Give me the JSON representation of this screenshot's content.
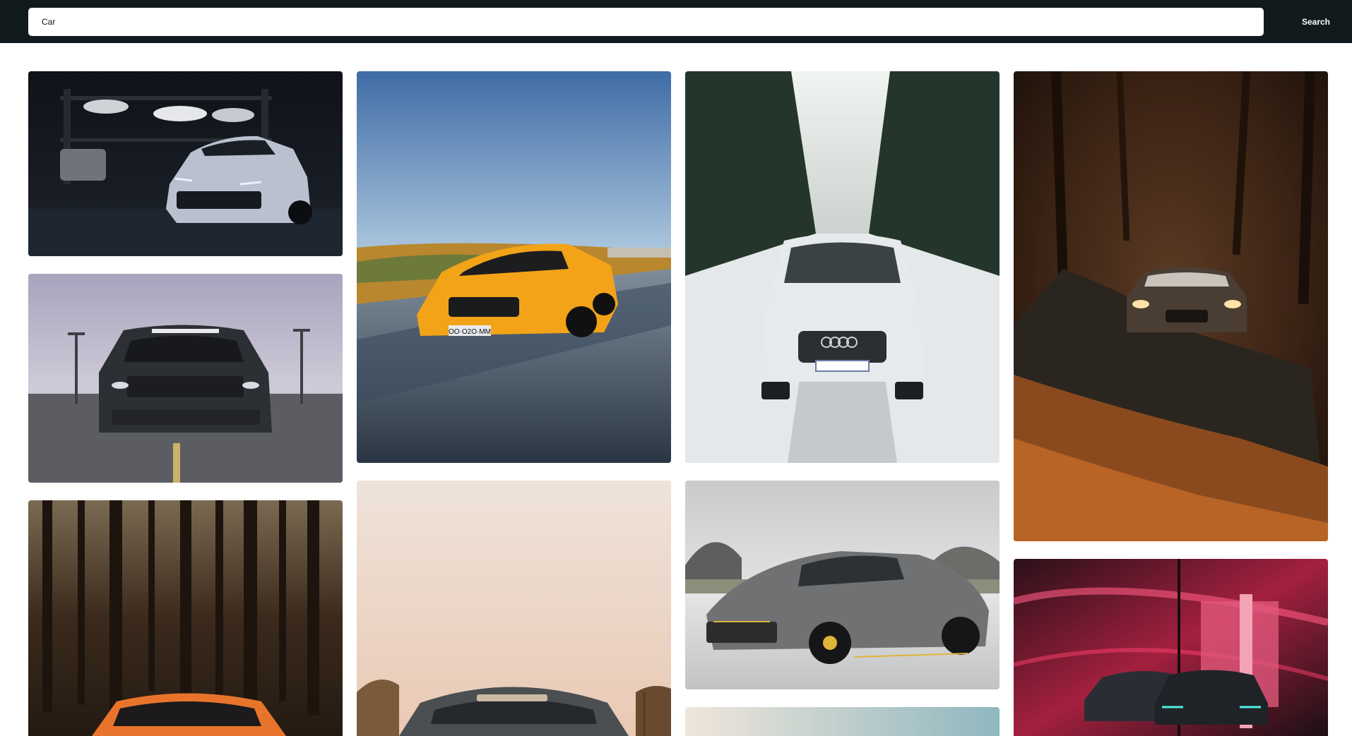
{
  "search": {
    "value": "Car",
    "placeholder": "",
    "button_label": "Search"
  },
  "results": [
    {
      "subject": "white Chevrolet Camaro in dark garage with stacked cars"
    },
    {
      "subject": "gray Ford Mustang Steeda on empty parking lot under cloudy sky"
    },
    {
      "subject": "orange sports car in dark autumn forest"
    },
    {
      "subject": "yellow Mercedes-AMG GT driving on road under blue sky",
      "plate": "OO·O2O·MM"
    },
    {
      "subject": "gray Dodge Challenger on pale peach background with palm trees"
    },
    {
      "subject": "white Audi Q5 on snowy forest road"
    },
    {
      "subject": "gray Mercedes-AMG GT R with yellow accents on overcast road"
    },
    {
      "subject": "landscape with pale sky"
    },
    {
      "subject": "dark Audi R8 with headlights on autumn leaf-covered road"
    },
    {
      "subject": "BMW in neon red showroom at night"
    }
  ]
}
